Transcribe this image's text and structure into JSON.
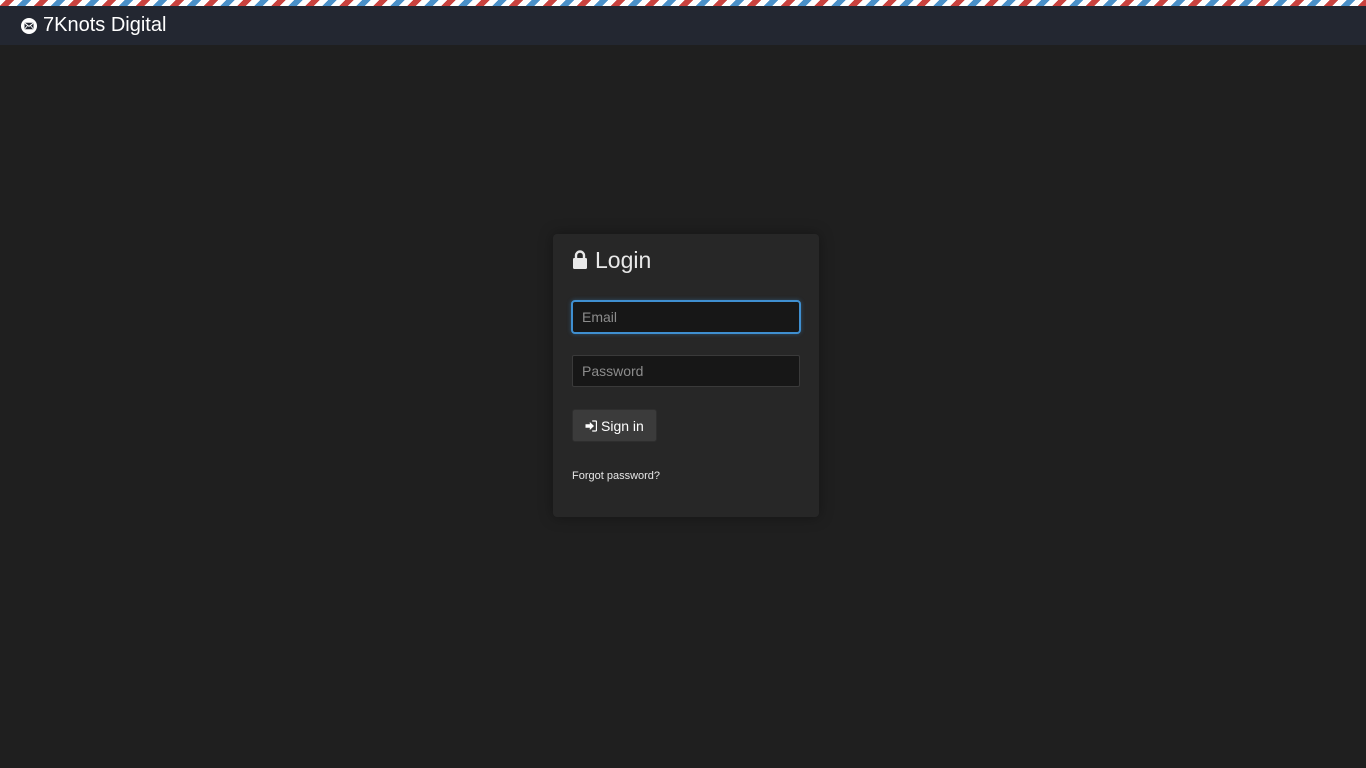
{
  "header": {
    "brand_name": "7Knots Digital",
    "logo_icon": "envelope-circle-icon",
    "stripe_colors": [
      "#c9423e",
      "#ffffff",
      "#4a90c8"
    ],
    "background": "#232731"
  },
  "login": {
    "title": "Login",
    "title_icon": "lock-icon",
    "email": {
      "placeholder": "Email",
      "value": "",
      "focused": true
    },
    "password": {
      "placeholder": "Password",
      "value": ""
    },
    "signin_button": {
      "label": "Sign in",
      "icon": "sign-in-icon"
    },
    "forgot_password_label": "Forgot password?"
  },
  "colors": {
    "page_background": "#1f1f1f",
    "card_background": "#272727",
    "focus_accent": "#3f8fd0"
  }
}
